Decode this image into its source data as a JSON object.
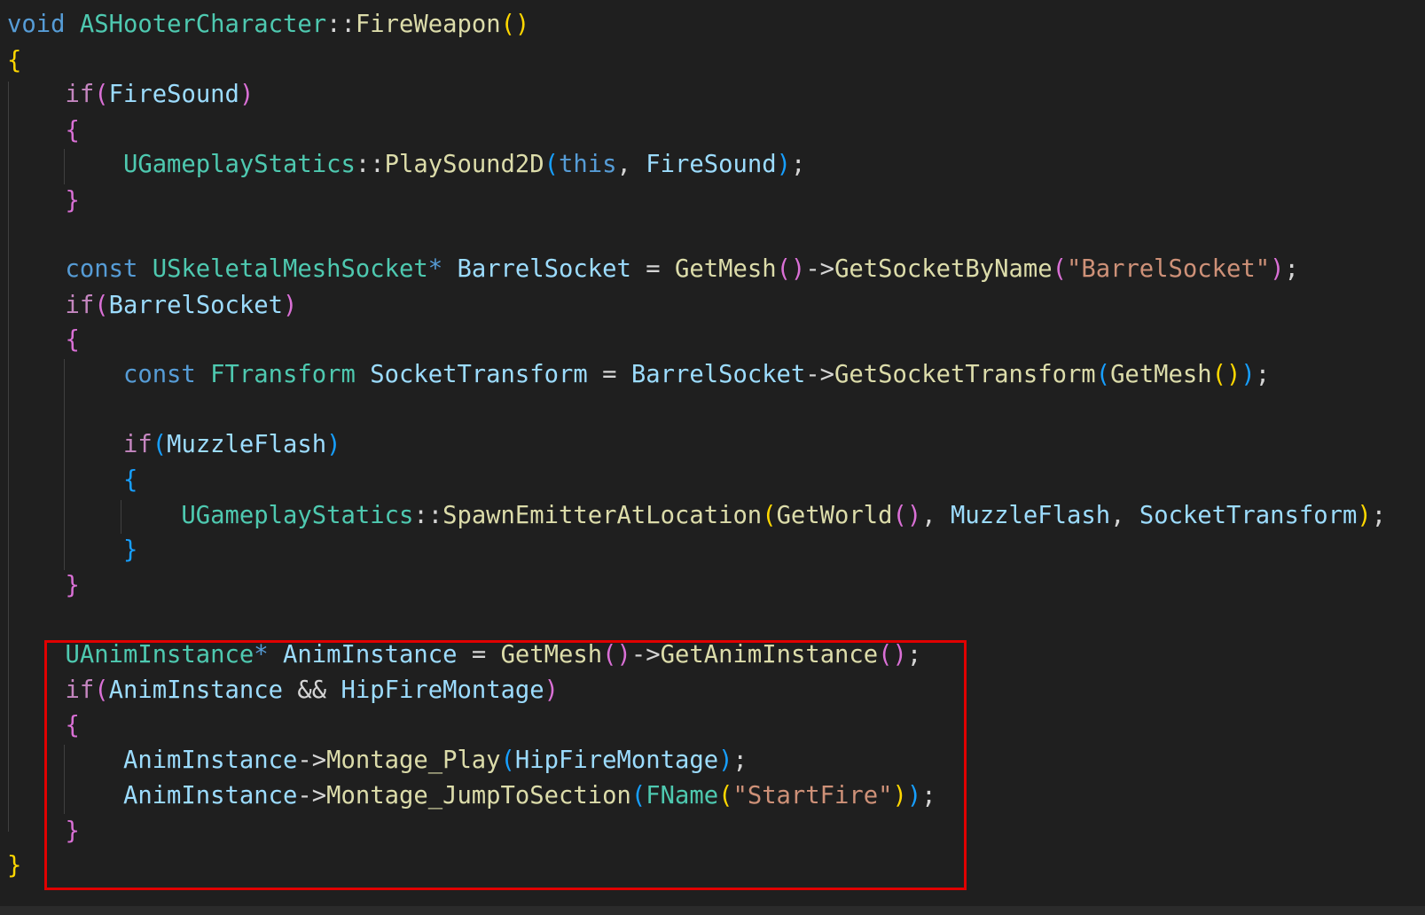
{
  "code": {
    "lines": [
      [
        {
          "t": "void",
          "c": "kw"
        },
        {
          "t": " ",
          "c": "pl"
        },
        {
          "t": "ASHooterCharacter",
          "c": "ty"
        },
        {
          "t": "::",
          "c": "pl"
        },
        {
          "t": "FireWeapon",
          "c": "fn"
        },
        {
          "t": "()",
          "c": "b1"
        }
      ],
      [
        {
          "t": "{",
          "c": "b1"
        }
      ],
      [
        {
          "t": "    ",
          "c": "pl"
        },
        {
          "t": "if",
          "c": "ctl"
        },
        {
          "t": "(",
          "c": "b2"
        },
        {
          "t": "FireSound",
          "c": "var"
        },
        {
          "t": ")",
          "c": "b2"
        }
      ],
      [
        {
          "t": "    ",
          "c": "pl"
        },
        {
          "t": "{",
          "c": "b2"
        }
      ],
      [
        {
          "t": "        ",
          "c": "pl"
        },
        {
          "t": "UGameplayStatics",
          "c": "ty"
        },
        {
          "t": "::",
          "c": "pl"
        },
        {
          "t": "PlaySound2D",
          "c": "fn"
        },
        {
          "t": "(",
          "c": "b3"
        },
        {
          "t": "this",
          "c": "kw"
        },
        {
          "t": ", ",
          "c": "pl"
        },
        {
          "t": "FireSound",
          "c": "var"
        },
        {
          "t": ")",
          "c": "b3"
        },
        {
          "t": ";",
          "c": "pl"
        }
      ],
      [
        {
          "t": "    ",
          "c": "pl"
        },
        {
          "t": "}",
          "c": "b2"
        }
      ],
      [],
      [
        {
          "t": "    ",
          "c": "pl"
        },
        {
          "t": "const",
          "c": "kw"
        },
        {
          "t": " ",
          "c": "pl"
        },
        {
          "t": "USkeletalMeshSocket",
          "c": "ty"
        },
        {
          "t": "* ",
          "c": "kw"
        },
        {
          "t": "BarrelSocket",
          "c": "var"
        },
        {
          "t": " = ",
          "c": "pl"
        },
        {
          "t": "GetMesh",
          "c": "fn"
        },
        {
          "t": "()",
          "c": "b2"
        },
        {
          "t": "->",
          "c": "pl"
        },
        {
          "t": "GetSocketByName",
          "c": "fn"
        },
        {
          "t": "(",
          "c": "b2"
        },
        {
          "t": "\"BarrelSocket\"",
          "c": "str"
        },
        {
          "t": ")",
          "c": "b2"
        },
        {
          "t": ";",
          "c": "pl"
        }
      ],
      [
        {
          "t": "    ",
          "c": "pl"
        },
        {
          "t": "if",
          "c": "ctl"
        },
        {
          "t": "(",
          "c": "b2"
        },
        {
          "t": "BarrelSocket",
          "c": "var"
        },
        {
          "t": ")",
          "c": "b2"
        }
      ],
      [
        {
          "t": "    ",
          "c": "pl"
        },
        {
          "t": "{",
          "c": "b2"
        }
      ],
      [
        {
          "t": "        ",
          "c": "pl"
        },
        {
          "t": "const",
          "c": "kw"
        },
        {
          "t": " ",
          "c": "pl"
        },
        {
          "t": "FTransform",
          "c": "ty"
        },
        {
          "t": " ",
          "c": "pl"
        },
        {
          "t": "SocketTransform",
          "c": "var"
        },
        {
          "t": " = ",
          "c": "pl"
        },
        {
          "t": "BarrelSocket",
          "c": "var"
        },
        {
          "t": "->",
          "c": "pl"
        },
        {
          "t": "GetSocketTransform",
          "c": "fn"
        },
        {
          "t": "(",
          "c": "b3"
        },
        {
          "t": "GetMesh",
          "c": "fn"
        },
        {
          "t": "()",
          "c": "b1"
        },
        {
          "t": ")",
          "c": "b3"
        },
        {
          "t": ";",
          "c": "pl"
        }
      ],
      [],
      [
        {
          "t": "        ",
          "c": "pl"
        },
        {
          "t": "if",
          "c": "ctl"
        },
        {
          "t": "(",
          "c": "b3"
        },
        {
          "t": "MuzzleFlash",
          "c": "var"
        },
        {
          "t": ")",
          "c": "b3"
        }
      ],
      [
        {
          "t": "        ",
          "c": "pl"
        },
        {
          "t": "{",
          "c": "b3"
        }
      ],
      [
        {
          "t": "            ",
          "c": "pl"
        },
        {
          "t": "UGameplayStatics",
          "c": "ty"
        },
        {
          "t": "::",
          "c": "pl"
        },
        {
          "t": "SpawnEmitterAtLocation",
          "c": "fn"
        },
        {
          "t": "(",
          "c": "b1"
        },
        {
          "t": "GetWorld",
          "c": "fn"
        },
        {
          "t": "()",
          "c": "b2"
        },
        {
          "t": ", ",
          "c": "pl"
        },
        {
          "t": "MuzzleFlash",
          "c": "var"
        },
        {
          "t": ", ",
          "c": "pl"
        },
        {
          "t": "SocketTransform",
          "c": "var"
        },
        {
          "t": ")",
          "c": "b1"
        },
        {
          "t": ";",
          "c": "pl"
        }
      ],
      [
        {
          "t": "        ",
          "c": "pl"
        },
        {
          "t": "}",
          "c": "b3"
        }
      ],
      [
        {
          "t": "    ",
          "c": "pl"
        },
        {
          "t": "}",
          "c": "b2"
        }
      ],
      [],
      [
        {
          "t": "    ",
          "c": "pl"
        },
        {
          "t": "UAnimInstance",
          "c": "ty"
        },
        {
          "t": "* ",
          "c": "kw"
        },
        {
          "t": "AnimInstance",
          "c": "var"
        },
        {
          "t": " = ",
          "c": "pl"
        },
        {
          "t": "GetMesh",
          "c": "fn"
        },
        {
          "t": "()",
          "c": "b2"
        },
        {
          "t": "->",
          "c": "pl"
        },
        {
          "t": "GetAnimInstance",
          "c": "fn"
        },
        {
          "t": "()",
          "c": "b2"
        },
        {
          "t": ";",
          "c": "pl"
        }
      ],
      [
        {
          "t": "    ",
          "c": "pl"
        },
        {
          "t": "if",
          "c": "ctl"
        },
        {
          "t": "(",
          "c": "b2"
        },
        {
          "t": "AnimInstance",
          "c": "var"
        },
        {
          "t": " && ",
          "c": "pl"
        },
        {
          "t": "HipFireMontage",
          "c": "var"
        },
        {
          "t": ")",
          "c": "b2"
        }
      ],
      [
        {
          "t": "    ",
          "c": "pl"
        },
        {
          "t": "{",
          "c": "b2"
        }
      ],
      [
        {
          "t": "        ",
          "c": "pl"
        },
        {
          "t": "AnimInstance",
          "c": "var"
        },
        {
          "t": "->",
          "c": "pl"
        },
        {
          "t": "Montage_Play",
          "c": "fn"
        },
        {
          "t": "(",
          "c": "b3"
        },
        {
          "t": "HipFireMontage",
          "c": "var"
        },
        {
          "t": ")",
          "c": "b3"
        },
        {
          "t": ";",
          "c": "pl"
        }
      ],
      [
        {
          "t": "        ",
          "c": "pl"
        },
        {
          "t": "AnimInstance",
          "c": "var"
        },
        {
          "t": "->",
          "c": "pl"
        },
        {
          "t": "Montage_JumpToSection",
          "c": "fn"
        },
        {
          "t": "(",
          "c": "b3"
        },
        {
          "t": "FName",
          "c": "ty"
        },
        {
          "t": "(",
          "c": "b1"
        },
        {
          "t": "\"StartFire\"",
          "c": "str"
        },
        {
          "t": ")",
          "c": "b1"
        },
        {
          "t": ")",
          "c": "b3"
        },
        {
          "t": ";",
          "c": "pl"
        }
      ],
      [
        {
          "t": "    ",
          "c": "pl"
        },
        {
          "t": "}",
          "c": "b2"
        }
      ],
      [
        {
          "t": "}",
          "c": "b1"
        }
      ]
    ]
  },
  "highlight": {
    "color": "#e00000"
  }
}
